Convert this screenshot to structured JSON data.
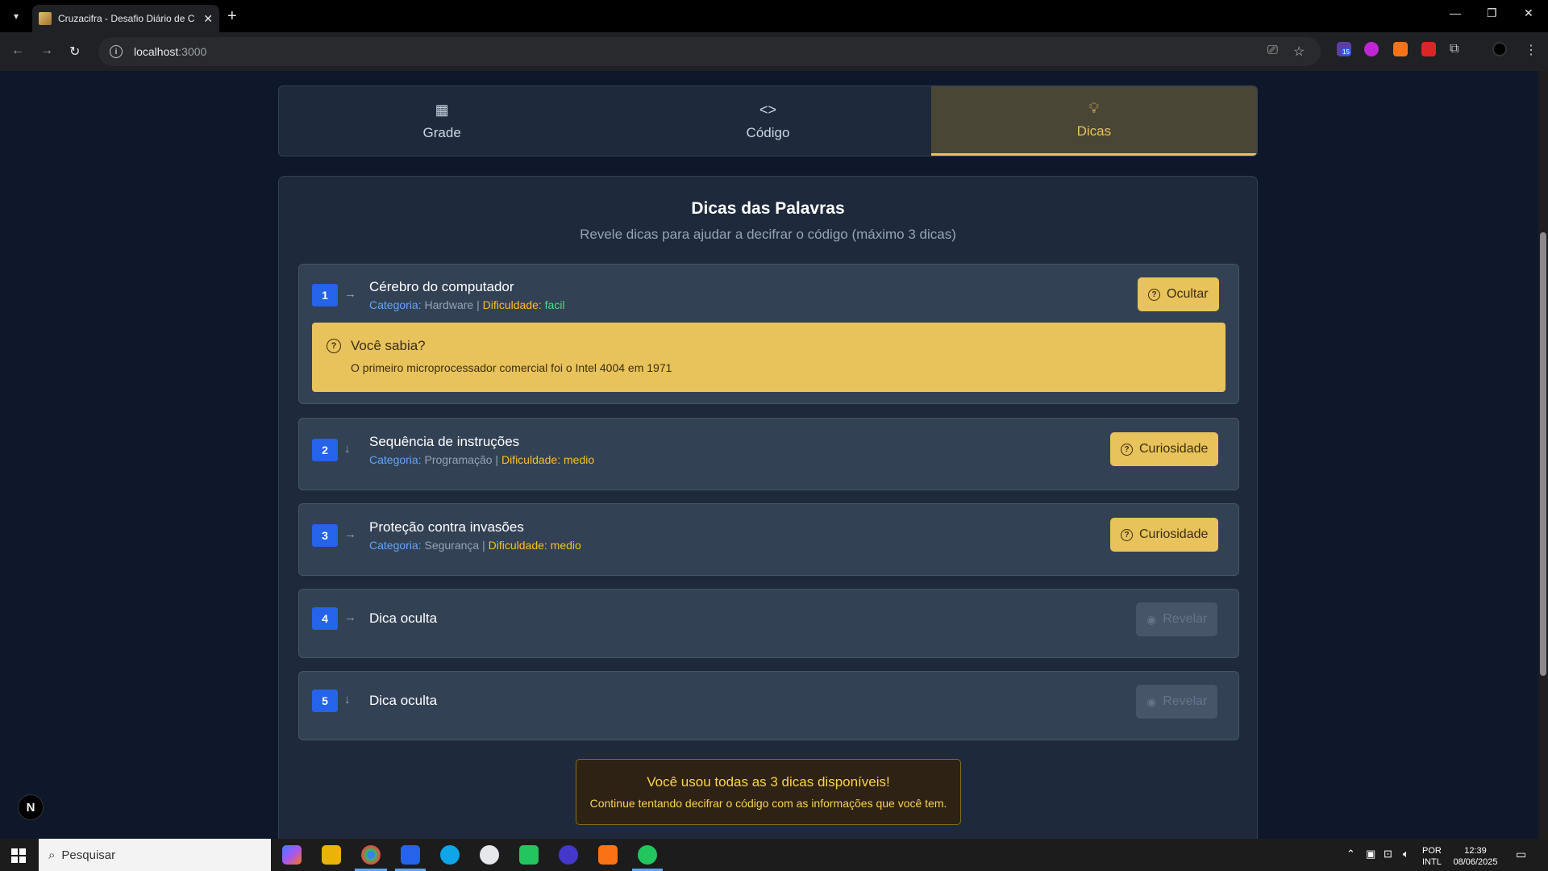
{
  "browser": {
    "tab_title": "Cruzacifra - Desafio Diário de C",
    "url_host": "localhost",
    "url_port": ":3000"
  },
  "nav_tabs": [
    {
      "label": "Grade",
      "icon": "grid-icon"
    },
    {
      "label": "Código",
      "icon": "code-icon"
    },
    {
      "label": "Dicas",
      "icon": "lightbulb-icon",
      "active": true
    }
  ],
  "panel": {
    "title": "Dicas das Palavras",
    "subtitle": "Revele dicas para ajudar a decifrar o código (máximo 3 dicas)"
  },
  "hints": [
    {
      "number": "1",
      "direction": "→",
      "title": "Cérebro do computador",
      "category_label": "Categoria:",
      "category": "Hardware",
      "separator": "|",
      "difficulty_label": "Dificuldade:",
      "difficulty": "facil",
      "button": "Ocultar",
      "fact_heading": "Você sabia?",
      "fact_text": "O primeiro microprocessador comercial foi o Intel 4004 em 1971"
    },
    {
      "number": "2",
      "direction": "↓",
      "title": "Sequência de instruções",
      "category_label": "Categoria:",
      "category": "Programação",
      "separator": "|",
      "difficulty_label": "Dificuldade:",
      "difficulty": "medio",
      "button": "Curiosidade"
    },
    {
      "number": "3",
      "direction": "→",
      "title": "Proteção contra invasões",
      "category_label": "Categoria:",
      "category": "Segurança",
      "separator": "|",
      "difficulty_label": "Dificuldade:",
      "difficulty": "medio",
      "button": "Curiosidade"
    },
    {
      "number": "4",
      "direction": "→",
      "title": "Dica oculta",
      "button": "Revelar"
    },
    {
      "number": "5",
      "direction": "↓",
      "title": "Dica oculta",
      "button": "Revelar"
    }
  ],
  "notice": {
    "heading": "Você usou todas as 3 dicas disponíveis!",
    "text": "Continue tentando decifrar o código com as informações que você tem."
  },
  "dev_badge": "N",
  "taskbar": {
    "search_placeholder": "Pesquisar",
    "lang_top": "POR",
    "lang_bottom": "INTL",
    "time": "12:39",
    "date": "08/06/2025"
  },
  "extension_badge": "15"
}
